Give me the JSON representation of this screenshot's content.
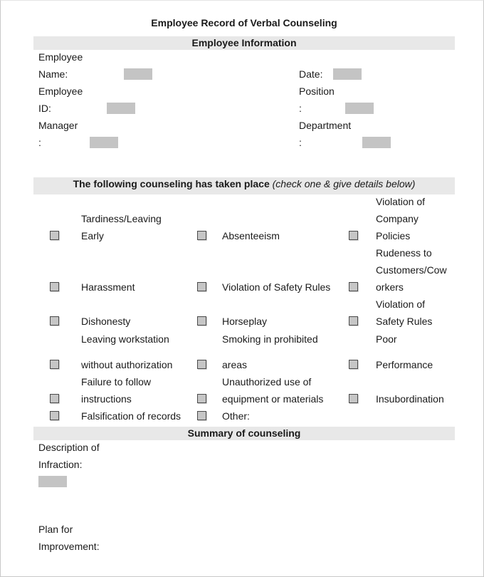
{
  "title": "Employee Record of Verbal Counseling",
  "sections": {
    "employee_info": "Employee Information",
    "counseling": {
      "label": "The following counseling has taken place",
      "hint": "(check one & give details below)"
    },
    "summary": "Summary of counseling"
  },
  "employee_info": {
    "name_line1": "Employee",
    "name_line2": "Name:",
    "id_line1": "Employee",
    "id_line2": "ID:",
    "manager_line1": "Manager",
    "manager_line2": ":",
    "date_label": "Date:",
    "position_line1": "Position",
    "position_line2": ":",
    "department_line1": "Department",
    "department_line2": ":"
  },
  "counseling_options": {
    "col1": [
      [
        "Tardiness/Leaving",
        "Early"
      ],
      [
        "Harassment"
      ],
      [
        "Dishonesty"
      ],
      [
        "Leaving workstation",
        "without authorization"
      ],
      [
        "Failure to follow",
        "instructions"
      ],
      [
        "Falsification of records"
      ]
    ],
    "col2": [
      [
        "Absenteeism"
      ],
      [
        "Violation of Safety Rules"
      ],
      [
        "Horseplay"
      ],
      [
        "Smoking in prohibited",
        "areas"
      ],
      [
        "Unauthorized use of",
        "equipment or materials"
      ],
      [
        "Other:"
      ]
    ],
    "col3": [
      [
        "Violation of",
        "Company",
        "Policies"
      ],
      [
        "Rudeness to",
        "Customers/Cow",
        "orkers"
      ],
      [
        "Violation of",
        "Safety Rules"
      ],
      [
        "Poor",
        "Performance"
      ],
      [
        "Insubordination"
      ]
    ]
  },
  "summary": {
    "description_line1": "Description of",
    "description_line2": "Infraction:",
    "plan_line1": "Plan for",
    "plan_line2": "Improvement:"
  }
}
